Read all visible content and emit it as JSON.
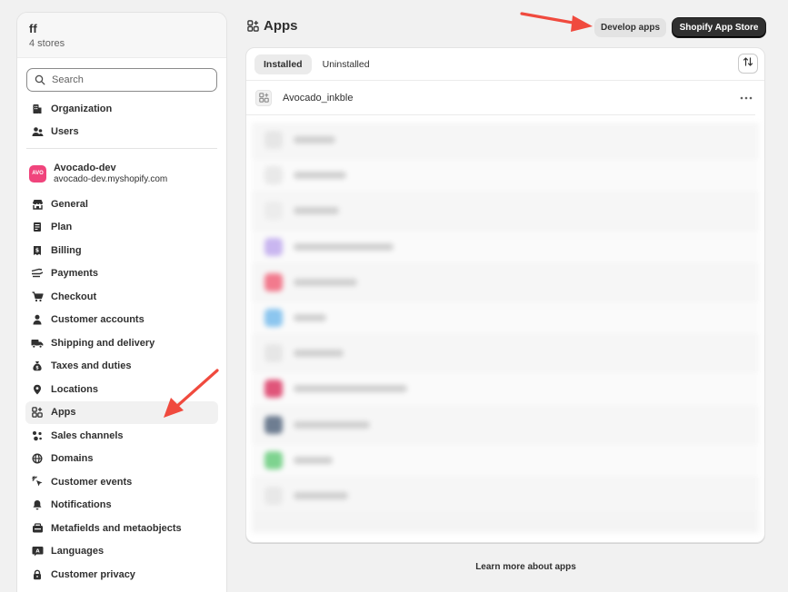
{
  "org": {
    "name": "ff",
    "stores": "4 stores"
  },
  "search": {
    "placeholder": "Search"
  },
  "nav_top": [
    {
      "label": "Organization",
      "icon": "building-icon"
    },
    {
      "label": "Users",
      "icon": "users-icon"
    }
  ],
  "store": {
    "badge": "AVO",
    "name": "Avocado-dev",
    "url": "avocado-dev.myshopify.com",
    "badge_color": "#f0447c"
  },
  "nav_store": [
    {
      "label": "General",
      "icon": "storefront-icon"
    },
    {
      "label": "Plan",
      "icon": "plan-icon"
    },
    {
      "label": "Billing",
      "icon": "receipt-icon"
    },
    {
      "label": "Payments",
      "icon": "payments-icon"
    },
    {
      "label": "Checkout",
      "icon": "cart-icon"
    },
    {
      "label": "Customer accounts",
      "icon": "person-icon"
    },
    {
      "label": "Shipping and delivery",
      "icon": "truck-icon"
    },
    {
      "label": "Taxes and duties",
      "icon": "money-bag-icon"
    },
    {
      "label": "Locations",
      "icon": "location-pin-icon"
    },
    {
      "label": "Apps",
      "icon": "apps-icon",
      "active": true
    },
    {
      "label": "Sales channels",
      "icon": "channels-icon"
    },
    {
      "label": "Domains",
      "icon": "globe-icon"
    },
    {
      "label": "Customer events",
      "icon": "cursor-click-icon"
    },
    {
      "label": "Notifications",
      "icon": "bell-icon"
    },
    {
      "label": "Metafields and metaobjects",
      "icon": "database-icon"
    },
    {
      "label": "Languages",
      "icon": "translate-icon"
    },
    {
      "label": "Customer privacy",
      "icon": "lock-icon"
    }
  ],
  "page": {
    "title": "Apps"
  },
  "actions": {
    "develop_label": "Develop apps",
    "store_label": "Shopify App Store"
  },
  "tabs": [
    {
      "label": "Installed",
      "selected": true
    },
    {
      "label": "Uninstalled",
      "selected": false
    }
  ],
  "installed_app": {
    "name": "Avocado_inkble"
  },
  "blurred_icon_colors": [
    "#e6e6e6",
    "#e9e9e9",
    "#ececec",
    "#c9b6f0",
    "#f27a8d",
    "#8cc6ef",
    "#e6e6e6",
    "#e0557a",
    "#6e7d91",
    "#7ed38f",
    "#e8e8e8"
  ],
  "footer": {
    "learn_more": "Learn more about apps"
  },
  "colors": {
    "accent_dark": "#303030",
    "annotation_arrow": "#f04a3e"
  }
}
